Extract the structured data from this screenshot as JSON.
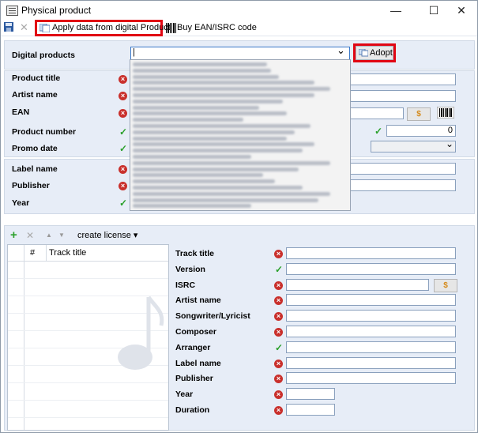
{
  "window": {
    "title": "Physical product",
    "minimize": "—",
    "maximize": "☐",
    "close": "✕"
  },
  "toolbar": {
    "apply_label": "Apply data from digital Product",
    "buy_label": "Buy EAN/ISRC code"
  },
  "digital": {
    "label": "Digital products",
    "combo_value": "|",
    "adopt_label": "Adopt"
  },
  "product": {
    "title_label": "Product title",
    "artist_label": "Artist name",
    "ean_label": "EAN",
    "number_label": "Product number",
    "number_value": "0",
    "promo_label": "Promo date"
  },
  "label": {
    "label_name": "Label name",
    "publisher": "Publisher",
    "year": "Year"
  },
  "tracks": {
    "create_license": "create license ▾",
    "col_num": "#",
    "col_title": "Track title",
    "fields": [
      {
        "label": "Track title",
        "status": "error"
      },
      {
        "label": "Version",
        "status": "ok"
      },
      {
        "label": "ISRC",
        "status": "error"
      },
      {
        "label": "Artist name",
        "status": "error"
      },
      {
        "label": "Songwriter/Lyricist",
        "status": "error"
      },
      {
        "label": "Composer",
        "status": "error"
      },
      {
        "label": "Arranger",
        "status": "ok"
      },
      {
        "label": "Label name",
        "status": "error"
      },
      {
        "label": "Publisher",
        "status": "error"
      },
      {
        "label": "Year",
        "status": "error"
      },
      {
        "label": "Duration",
        "status": "error"
      }
    ]
  },
  "symbols": {
    "error": "×",
    "ok": "✓",
    "dollar": "$",
    "dropdown_arrow": "⌄",
    "add": "+",
    "remove": "✕",
    "up": "▲",
    "down": "▼"
  },
  "colors": {
    "accent_red": "#e10613",
    "panel_bg": "#e7edf7",
    "error": "#c9302c",
    "ok": "#2aa02a"
  }
}
